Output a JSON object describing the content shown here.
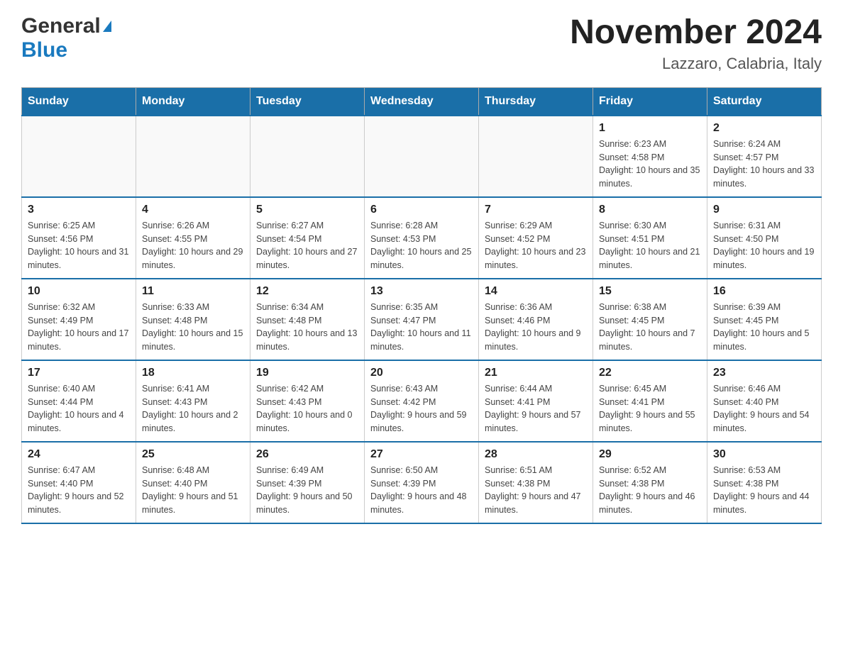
{
  "header": {
    "logo": {
      "general": "General",
      "blue": "Blue",
      "triangle": "▶"
    },
    "title": "November 2024",
    "location": "Lazzaro, Calabria, Italy"
  },
  "calendar": {
    "days_of_week": [
      "Sunday",
      "Monday",
      "Tuesday",
      "Wednesday",
      "Thursday",
      "Friday",
      "Saturday"
    ],
    "weeks": [
      [
        {
          "day": "",
          "info": ""
        },
        {
          "day": "",
          "info": ""
        },
        {
          "day": "",
          "info": ""
        },
        {
          "day": "",
          "info": ""
        },
        {
          "day": "",
          "info": ""
        },
        {
          "day": "1",
          "info": "Sunrise: 6:23 AM\nSunset: 4:58 PM\nDaylight: 10 hours and 35 minutes."
        },
        {
          "day": "2",
          "info": "Sunrise: 6:24 AM\nSunset: 4:57 PM\nDaylight: 10 hours and 33 minutes."
        }
      ],
      [
        {
          "day": "3",
          "info": "Sunrise: 6:25 AM\nSunset: 4:56 PM\nDaylight: 10 hours and 31 minutes."
        },
        {
          "day": "4",
          "info": "Sunrise: 6:26 AM\nSunset: 4:55 PM\nDaylight: 10 hours and 29 minutes."
        },
        {
          "day": "5",
          "info": "Sunrise: 6:27 AM\nSunset: 4:54 PM\nDaylight: 10 hours and 27 minutes."
        },
        {
          "day": "6",
          "info": "Sunrise: 6:28 AM\nSunset: 4:53 PM\nDaylight: 10 hours and 25 minutes."
        },
        {
          "day": "7",
          "info": "Sunrise: 6:29 AM\nSunset: 4:52 PM\nDaylight: 10 hours and 23 minutes."
        },
        {
          "day": "8",
          "info": "Sunrise: 6:30 AM\nSunset: 4:51 PM\nDaylight: 10 hours and 21 minutes."
        },
        {
          "day": "9",
          "info": "Sunrise: 6:31 AM\nSunset: 4:50 PM\nDaylight: 10 hours and 19 minutes."
        }
      ],
      [
        {
          "day": "10",
          "info": "Sunrise: 6:32 AM\nSunset: 4:49 PM\nDaylight: 10 hours and 17 minutes."
        },
        {
          "day": "11",
          "info": "Sunrise: 6:33 AM\nSunset: 4:48 PM\nDaylight: 10 hours and 15 minutes."
        },
        {
          "day": "12",
          "info": "Sunrise: 6:34 AM\nSunset: 4:48 PM\nDaylight: 10 hours and 13 minutes."
        },
        {
          "day": "13",
          "info": "Sunrise: 6:35 AM\nSunset: 4:47 PM\nDaylight: 10 hours and 11 minutes."
        },
        {
          "day": "14",
          "info": "Sunrise: 6:36 AM\nSunset: 4:46 PM\nDaylight: 10 hours and 9 minutes."
        },
        {
          "day": "15",
          "info": "Sunrise: 6:38 AM\nSunset: 4:45 PM\nDaylight: 10 hours and 7 minutes."
        },
        {
          "day": "16",
          "info": "Sunrise: 6:39 AM\nSunset: 4:45 PM\nDaylight: 10 hours and 5 minutes."
        }
      ],
      [
        {
          "day": "17",
          "info": "Sunrise: 6:40 AM\nSunset: 4:44 PM\nDaylight: 10 hours and 4 minutes."
        },
        {
          "day": "18",
          "info": "Sunrise: 6:41 AM\nSunset: 4:43 PM\nDaylight: 10 hours and 2 minutes."
        },
        {
          "day": "19",
          "info": "Sunrise: 6:42 AM\nSunset: 4:43 PM\nDaylight: 10 hours and 0 minutes."
        },
        {
          "day": "20",
          "info": "Sunrise: 6:43 AM\nSunset: 4:42 PM\nDaylight: 9 hours and 59 minutes."
        },
        {
          "day": "21",
          "info": "Sunrise: 6:44 AM\nSunset: 4:41 PM\nDaylight: 9 hours and 57 minutes."
        },
        {
          "day": "22",
          "info": "Sunrise: 6:45 AM\nSunset: 4:41 PM\nDaylight: 9 hours and 55 minutes."
        },
        {
          "day": "23",
          "info": "Sunrise: 6:46 AM\nSunset: 4:40 PM\nDaylight: 9 hours and 54 minutes."
        }
      ],
      [
        {
          "day": "24",
          "info": "Sunrise: 6:47 AM\nSunset: 4:40 PM\nDaylight: 9 hours and 52 minutes."
        },
        {
          "day": "25",
          "info": "Sunrise: 6:48 AM\nSunset: 4:40 PM\nDaylight: 9 hours and 51 minutes."
        },
        {
          "day": "26",
          "info": "Sunrise: 6:49 AM\nSunset: 4:39 PM\nDaylight: 9 hours and 50 minutes."
        },
        {
          "day": "27",
          "info": "Sunrise: 6:50 AM\nSunset: 4:39 PM\nDaylight: 9 hours and 48 minutes."
        },
        {
          "day": "28",
          "info": "Sunrise: 6:51 AM\nSunset: 4:38 PM\nDaylight: 9 hours and 47 minutes."
        },
        {
          "day": "29",
          "info": "Sunrise: 6:52 AM\nSunset: 4:38 PM\nDaylight: 9 hours and 46 minutes."
        },
        {
          "day": "30",
          "info": "Sunrise: 6:53 AM\nSunset: 4:38 PM\nDaylight: 9 hours and 44 minutes."
        }
      ]
    ]
  }
}
